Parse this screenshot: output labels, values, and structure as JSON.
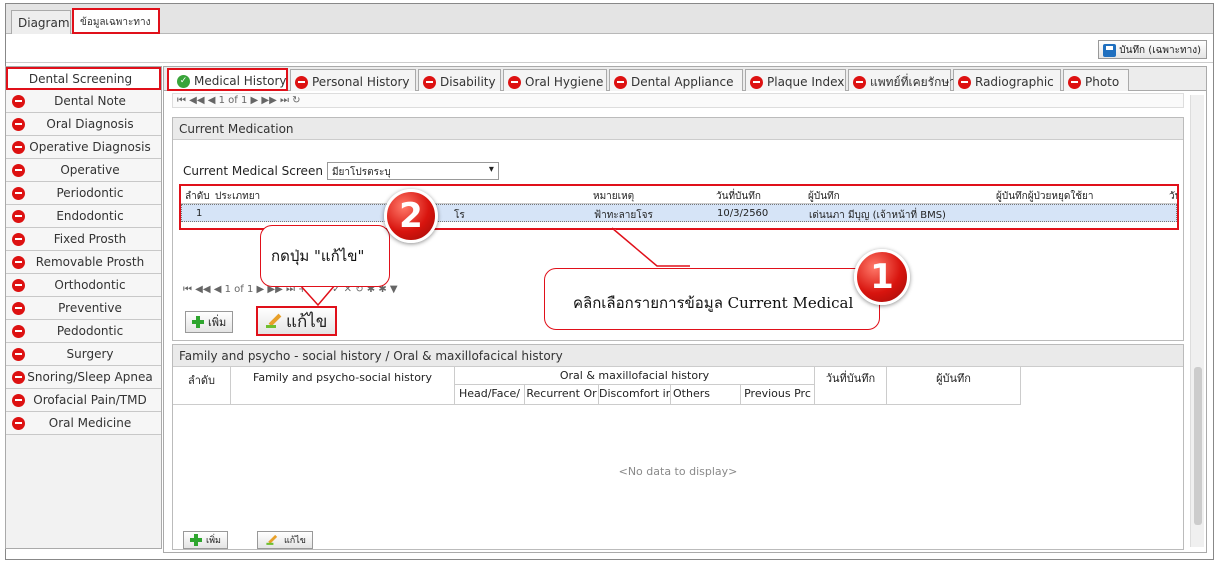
{
  "top_tabs": [
    "Diagram",
    "ข้อมูลเฉพาะทาง"
  ],
  "save_button": "บันทึก (เฉพาะทาง)",
  "side_nav": [
    {
      "label": "Dental Screening",
      "status": "active"
    },
    {
      "label": "Dental Note",
      "status": "incomplete"
    },
    {
      "label": "Oral Diagnosis",
      "status": "incomplete"
    },
    {
      "label": "Operative Diagnosis",
      "status": "incomplete"
    },
    {
      "label": "Operative",
      "status": "incomplete"
    },
    {
      "label": "Periodontic",
      "status": "incomplete"
    },
    {
      "label": "Endodontic",
      "status": "incomplete"
    },
    {
      "label": "Fixed Prosth",
      "status": "incomplete"
    },
    {
      "label": "Removable Prosth",
      "status": "incomplete"
    },
    {
      "label": "Orthodontic",
      "status": "incomplete"
    },
    {
      "label": "Preventive",
      "status": "incomplete"
    },
    {
      "label": "Pedodontic",
      "status": "incomplete"
    },
    {
      "label": "Surgery",
      "status": "incomplete"
    },
    {
      "label": "Snoring/Sleep Apnea",
      "status": "incomplete"
    },
    {
      "label": "Orofacial Pain/TMD",
      "status": "incomplete"
    },
    {
      "label": "Oral Medicine",
      "status": "incomplete"
    }
  ],
  "main_tabs": [
    {
      "label": "Medical History",
      "status": "done"
    },
    {
      "label": "Personal History",
      "status": "incomplete"
    },
    {
      "label": "Disability",
      "status": "incomplete"
    },
    {
      "label": "Oral Hygiene",
      "status": "incomplete"
    },
    {
      "label": "Dental Appliance",
      "status": "incomplete"
    },
    {
      "label": "Plaque Index",
      "status": "incomplete"
    },
    {
      "label": "แพทย์ที่เคยรักษา",
      "status": "incomplete"
    },
    {
      "label": "Radiographic",
      "status": "incomplete"
    },
    {
      "label": "Photo",
      "status": "incomplete"
    }
  ],
  "top_pager": "1 of 1",
  "current_medication": {
    "title": "Current Medication",
    "screen_label": "Current Medical Screen",
    "screen_value": "มียาโปรตระบุ",
    "columns": [
      "ลำดับ",
      "ประเภทยา",
      "หมายเหตุ",
      "วันที่บันทึก",
      "ผู้บันทึก",
      "ผู้บันทึกผู้ป่วยหยุดใช้ยา",
      "วัน"
    ],
    "rows": [
      {
        "no": "1",
        "type": "โร",
        "note": "ฟ้าทะลายโจร",
        "date": "10/3/2560",
        "recorder": "เด่นนภา มีบุญ (เจ้าหน้าที่ BMS)"
      }
    ],
    "pager": "1 of 1",
    "add_label": "เพิ่ม",
    "edit_label": "แก้ไข"
  },
  "family_history": {
    "title": "Family and psycho - social history / Oral & maxillofacical history",
    "col_no": "ลำดับ",
    "col_family": "Family and psycho-social history",
    "col_oral": "Oral & maxillofacial history",
    "sub_columns": [
      "Head/Face/",
      "Recurrent Or",
      "Discomfort ir",
      "Others",
      "Previous Prc"
    ],
    "col_date": "วันที่บันทึก",
    "col_recorder": "ผู้บันทึก",
    "no_data": "<No data to display>",
    "add_label": "เพิ่ม",
    "edit_label": "แก้ไข"
  },
  "annotations": {
    "step1_number": "1",
    "step1_text": "คลิกเลือกรายการข้อมูล Current Medical",
    "step2_number": "2",
    "step2_text": "กดปุ่ม \"แก้ไข\""
  },
  "colors": {
    "highlight": "#e0101a",
    "selected_row": "#d6e4f7"
  }
}
